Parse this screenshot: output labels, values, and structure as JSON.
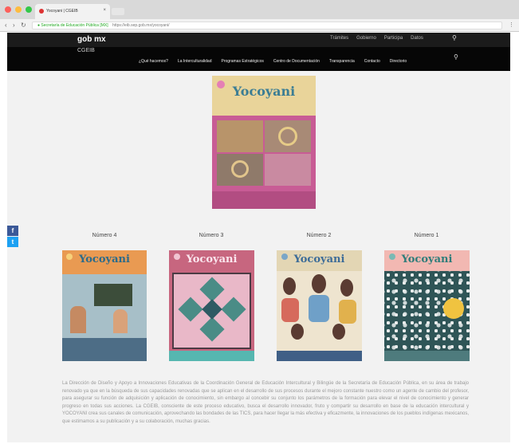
{
  "browser": {
    "tab_title": "Yocoyani | CGEIB",
    "tab_close": "×",
    "secure_label": "Secretaría de Educación Pública [MX]",
    "url": "https://eib.sep.gob.mx/yocoyani/",
    "menu": "⋮"
  },
  "header": {
    "logo_main": "gob mx",
    "logo_sub": "CGEIB",
    "top_links": [
      "Trámites",
      "Gobierno",
      "Participa",
      "Datos"
    ],
    "nav": [
      "¿Qué hacemos?",
      "La Interculturalidad",
      "Programas Estratégicos",
      "Centro de Documentación",
      "Transparencia",
      "Contacto",
      "Directorio"
    ]
  },
  "featured": {
    "title": "Yocoyani"
  },
  "issues": [
    {
      "label": "Número 4",
      "cover_title": "Yocoyani"
    },
    {
      "label": "Número 3",
      "cover_title": "Yocoyani"
    },
    {
      "label": "Número 2",
      "cover_title": "Yocoyani"
    },
    {
      "label": "Número 1",
      "cover_title": "Yocoyani"
    }
  ],
  "social": {
    "facebook": "f",
    "twitter": "t"
  },
  "description": "La Dirección de Diseño y Apoyo a Innovaciones Educativas de la Coordinación General de Educación Intercultural y Bilingüe de la Secretaría de Educación Pública, en su área de trabajo renovado ya que en la búsqueda de sus capacidades renovadas que se aplican en el desarrollo de sus procesos durante el mejoro constante nuestro como un agente de cambio del profesor, para asegurar su función de adquisición y aplicación de conocimiento, sin embargo al concebir su conjunto los parámetros de la formación para elevar el nivel de conocimiento y generar progreso en todas sus acciones. La CGEIB, consciente de este proceso educativo, busca el desarrollo innovador, fruto y compartir su desarrollo en base de la educación intercultural y YOCOYANI crea sus canales de comunicación, aprovechando las bondades de las TICS, para hacer llegar la más efectiva y eficazmente, la innovaciones de los pueblos indígenas mexicanos, que estimamos a su publicación y a su colaboración, muchas gracias.",
  "colors": {
    "header_bg": "#060606",
    "content_bg": "#f2f2f2",
    "facebook": "#3b5998",
    "twitter": "#1da1f2"
  }
}
